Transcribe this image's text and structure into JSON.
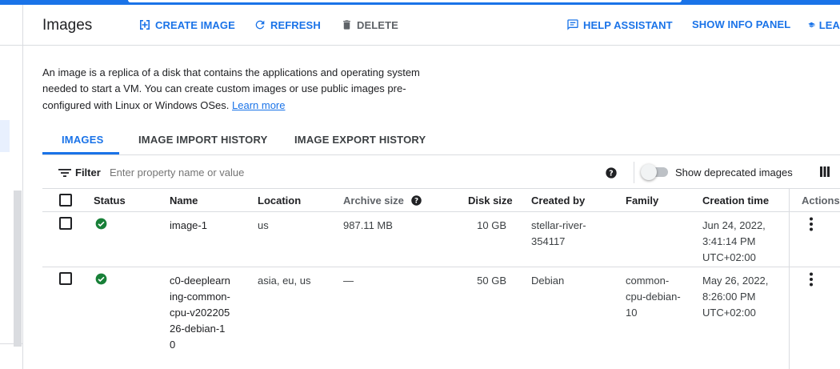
{
  "header": {
    "title": "Images",
    "create_label": "CREATE IMAGE",
    "refresh_label": "REFRESH",
    "delete_label": "DELETE",
    "help_assistant_label": "HELP ASSISTANT",
    "show_info_panel_label": "SHOW INFO PANEL",
    "learn_label": "LEA"
  },
  "description": {
    "text": "An image is a replica of a disk that contains the applications and operating system needed to start a VM. You can create custom images or use public images pre-configured with Linux or Windows OSes.",
    "learn_more": "Learn more"
  },
  "tabs": [
    {
      "label": "IMAGES",
      "active": true
    },
    {
      "label": "IMAGE IMPORT HISTORY",
      "active": false
    },
    {
      "label": "IMAGE EXPORT HISTORY",
      "active": false
    }
  ],
  "filter": {
    "label": "Filter",
    "placeholder": "Enter property name or value",
    "deprecated_toggle_label": "Show deprecated images",
    "deprecated_toggle_on": false
  },
  "table": {
    "columns": {
      "status": "Status",
      "name": "Name",
      "location": "Location",
      "archive_size": "Archive size",
      "disk_size": "Disk size",
      "created_by": "Created by",
      "family": "Family",
      "creation_time": "Creation time",
      "actions": "Actions"
    },
    "rows": [
      {
        "status": "ready",
        "name": "image-1",
        "location": "us",
        "archive_size": "987.11 MB",
        "disk_size": "10 GB",
        "created_by": "stellar-river-354117",
        "family": "",
        "creation_time": "Jun 24, 2022, 3:41:14 PM UTC+02:00"
      },
      {
        "status": "ready",
        "name": "c0-deeplearning-common-cpu-v20220526-debian-10",
        "location": "asia, eu, us",
        "archive_size": "—",
        "disk_size": "50 GB",
        "created_by": "Debian",
        "family": "common-cpu-debian-10",
        "creation_time": "May 26, 2022, 8:26:00 PM UTC+02:00"
      }
    ]
  },
  "colors": {
    "accent": "#1a73e8",
    "status_ok": "#188038",
    "divider": "#dadce0"
  },
  "icons": {
    "create": "add-box-icon",
    "refresh": "refresh-icon",
    "delete": "trash-icon",
    "help_assistant": "chat-help-icon",
    "learn": "school-icon",
    "filter": "filter-icon",
    "help": "help-circle-icon",
    "columns": "column-display-icon",
    "status": "check-circle-icon",
    "actions": "more-vert-icon"
  }
}
